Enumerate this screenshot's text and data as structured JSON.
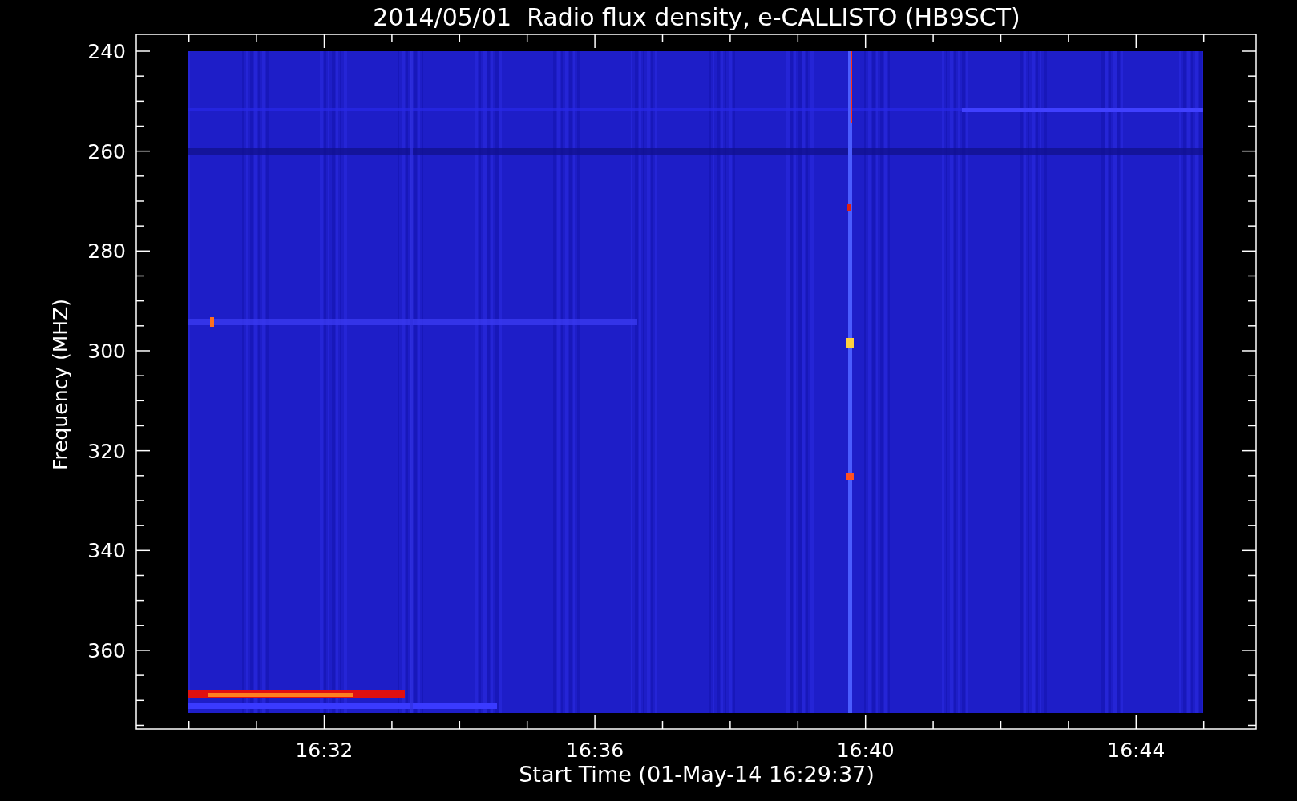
{
  "plot": {
    "title": "2014/05/01  Radio flux density, e-CALLISTO (HB9SCT)",
    "ylabel": "Frequency (MHZ)",
    "xlabel": "Start Time (01-May-14 16:29:37)",
    "y_tick_labels": [
      "240",
      "260",
      "280",
      "300",
      "320",
      "340",
      "360"
    ],
    "x_tick_labels": [
      "16:32",
      "16:36",
      "16:40",
      "16:44"
    ]
  }
}
